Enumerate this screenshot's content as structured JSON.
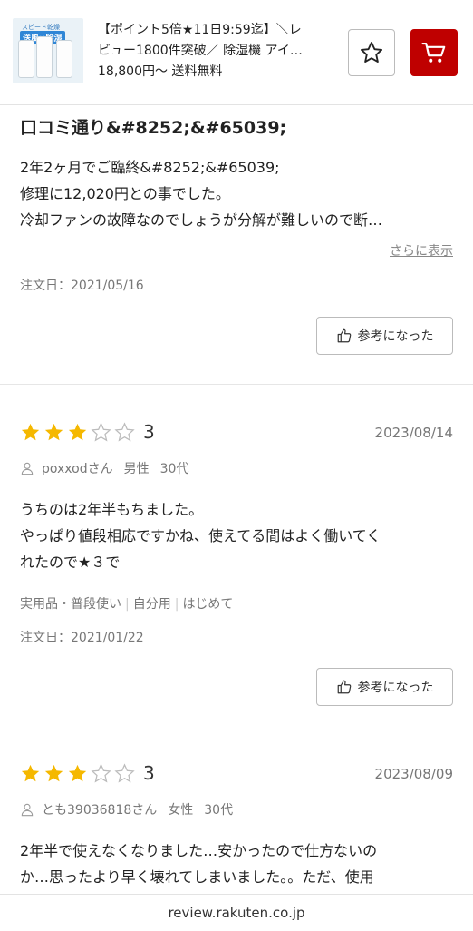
{
  "product": {
    "thumb_badge_top": "スピード乾燥",
    "thumb_badge": "送風×除湿",
    "title_line1": "【ポイント5倍★11日9:59迄】＼レ",
    "title_line2": "ビュー1800件突破／ 除湿機 アイ…",
    "price_line": "18,800円〜  送料無料",
    "favorite_icon": "star-outline-icon",
    "cart_icon": "cart-icon"
  },
  "reviews": [
    {
      "title": "口コミ通り&#8252;&#65039;",
      "body": [
        "2年2ヶ月でご臨終&#8252;&#65039;",
        "修理に12,020円との事でした。",
        "冷却ファンの故障なのでしょうが分解が難しいので断…"
      ],
      "more_label": "さらに表示",
      "order_date": "注文日：2021/05/16",
      "helpful_label": "参考になった"
    },
    {
      "rating": 3,
      "rating_label": "3",
      "date": "2023/08/14",
      "user": "poxxodさん",
      "gender": "男性",
      "age": "30代",
      "body": [
        "うちのは2年半もちました。",
        "やっぱり値段相応ですかね、使えてる間はよく働いてく",
        "れたので★３で"
      ],
      "tags": [
        "実用品・普段使い",
        "自分用",
        "はじめて"
      ],
      "order_date": "注文日：2021/01/22",
      "helpful_label": "参考になった"
    },
    {
      "rating": 3,
      "rating_label": "3",
      "date": "2023/08/09",
      "user": "とも39036818さん",
      "gender": "女性",
      "age": "30代",
      "body": [
        "2年半で使えなくなりました…安かったので仕方ないの",
        "か…思ったより早く壊れてしまいました。。ただ、使用"
      ]
    }
  ],
  "footer": {
    "domain": "review.rakuten.co.jp"
  },
  "colors": {
    "accent": "#bf0000",
    "star": "#f5b800"
  }
}
